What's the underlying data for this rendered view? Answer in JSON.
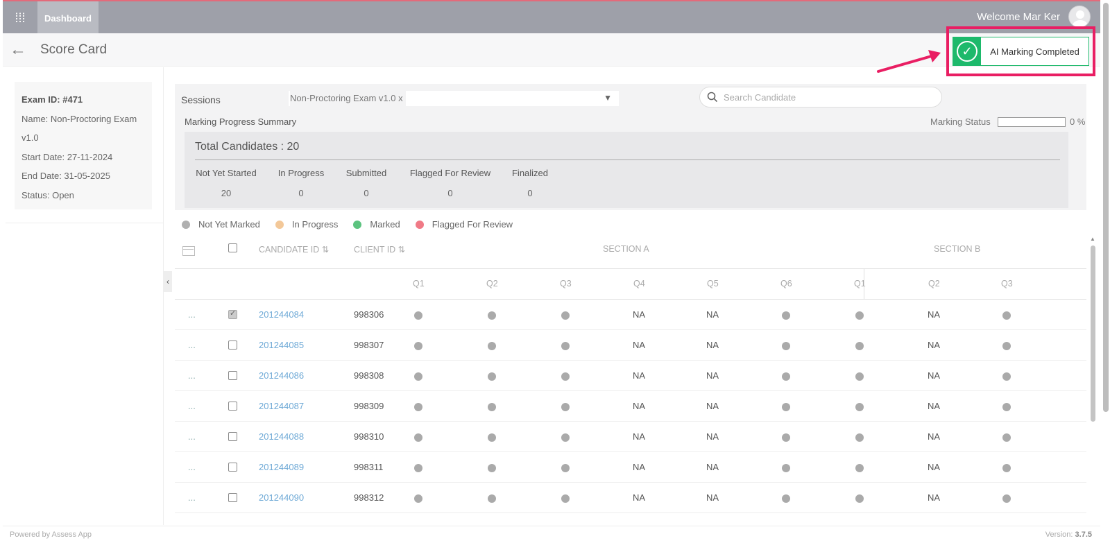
{
  "topbar": {
    "menu_icon": "grid-icon",
    "dashboard_label": "Dashboard",
    "welcome_text": "Welcome Mar Ker"
  },
  "header": {
    "title": "Score Card",
    "ai_status": "AI Marking Completed",
    "highlight_color": "#e91e63",
    "success_color": "#1db96b"
  },
  "exam": {
    "id": "Exam ID: #471",
    "name": "Name: Non-Proctoring Exam",
    "name_cont": "v1.0",
    "start_date": "Start Date: 27-11-2024",
    "end_date": "End Date: 31-05-2025",
    "status": "Status: Open"
  },
  "filters": {
    "sessions_label": "Sessions",
    "session_value": "Non-Proctoring Exam v1.0 x",
    "search_placeholder": "Search Candidate"
  },
  "summary": {
    "title": "Marking Progress Summary",
    "marking_status_label": "Marking Status",
    "marking_status_percent": 0,
    "marking_status_text": "0 %",
    "total_candidates": "Total Candidates : 20",
    "stats": [
      {
        "label": "Not Yet Started",
        "value": "20"
      },
      {
        "label": "In Progress",
        "value": "0"
      },
      {
        "label": "Submitted",
        "value": "0"
      },
      {
        "label": "Flagged For Review",
        "value": "0"
      },
      {
        "label": "Finalized",
        "value": "0"
      }
    ]
  },
  "legend": [
    {
      "label": "Not Yet Marked",
      "color": "#b0b0b0"
    },
    {
      "label": "In Progress",
      "color": "#f3c899"
    },
    {
      "label": "Marked",
      "color": "#5cc37f"
    },
    {
      "label": "Flagged For Review",
      "color": "#f07a86"
    }
  ],
  "table": {
    "headers": {
      "candidate_id": "CANDIDATE ID ⇅",
      "client_id": "CLIENT ID ⇅",
      "section_a": "SECTION A",
      "section_b": "SECTION B"
    },
    "questions": [
      "Q1",
      "Q2",
      "Q3",
      "Q4",
      "Q5",
      "Q6",
      "Q1",
      "Q2",
      "Q3"
    ],
    "row_menu": "...",
    "rows": [
      {
        "candidate_id": "201244084",
        "client_id": "998306",
        "checked": true
      },
      {
        "candidate_id": "201244085",
        "client_id": "998307",
        "checked": false
      },
      {
        "candidate_id": "201244086",
        "client_id": "998308",
        "checked": false
      },
      {
        "candidate_id": "201244087",
        "client_id": "998309",
        "checked": false
      },
      {
        "candidate_id": "201244088",
        "client_id": "998310",
        "checked": false
      },
      {
        "candidate_id": "201244089",
        "client_id": "998311",
        "checked": false
      },
      {
        "candidate_id": "201244090",
        "client_id": "998312",
        "checked": false
      }
    ],
    "cells": [
      "dot",
      "dot",
      "dot",
      "NA",
      "NA",
      "dot",
      "dot",
      "NA",
      "dot"
    ]
  },
  "footer": {
    "powered": "Powered by Assess App",
    "version_label": "Version: ",
    "version": "3.7.5"
  }
}
